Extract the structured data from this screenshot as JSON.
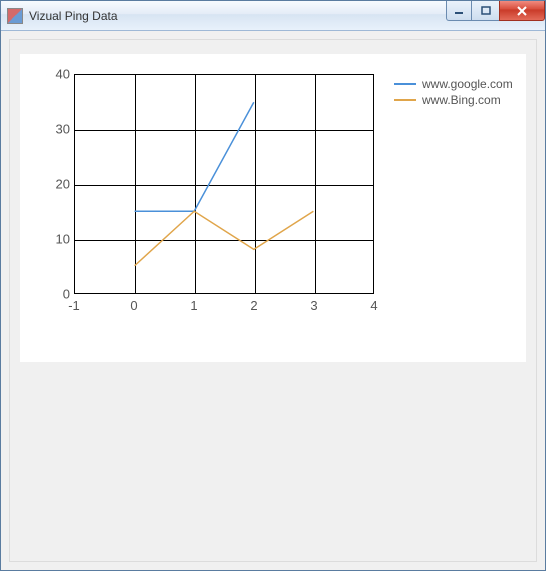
{
  "window": {
    "title": "Vizual Ping Data"
  },
  "chart_data": {
    "type": "line",
    "xlabel": "",
    "ylabel": "",
    "xlim": [
      -1,
      4
    ],
    "ylim": [
      0,
      40
    ],
    "xticks": [
      -1,
      0,
      1,
      2,
      3,
      4
    ],
    "yticks": [
      0,
      10,
      20,
      30,
      40
    ],
    "x": [
      0,
      1,
      2,
      3
    ],
    "series": [
      {
        "name": "www.google.com",
        "color": "#4a90d9",
        "values": [
          15,
          15,
          35,
          null
        ]
      },
      {
        "name": "www.Bing.com",
        "color": "#e0a54a",
        "values": [
          5,
          15,
          8,
          15
        ]
      }
    ]
  }
}
